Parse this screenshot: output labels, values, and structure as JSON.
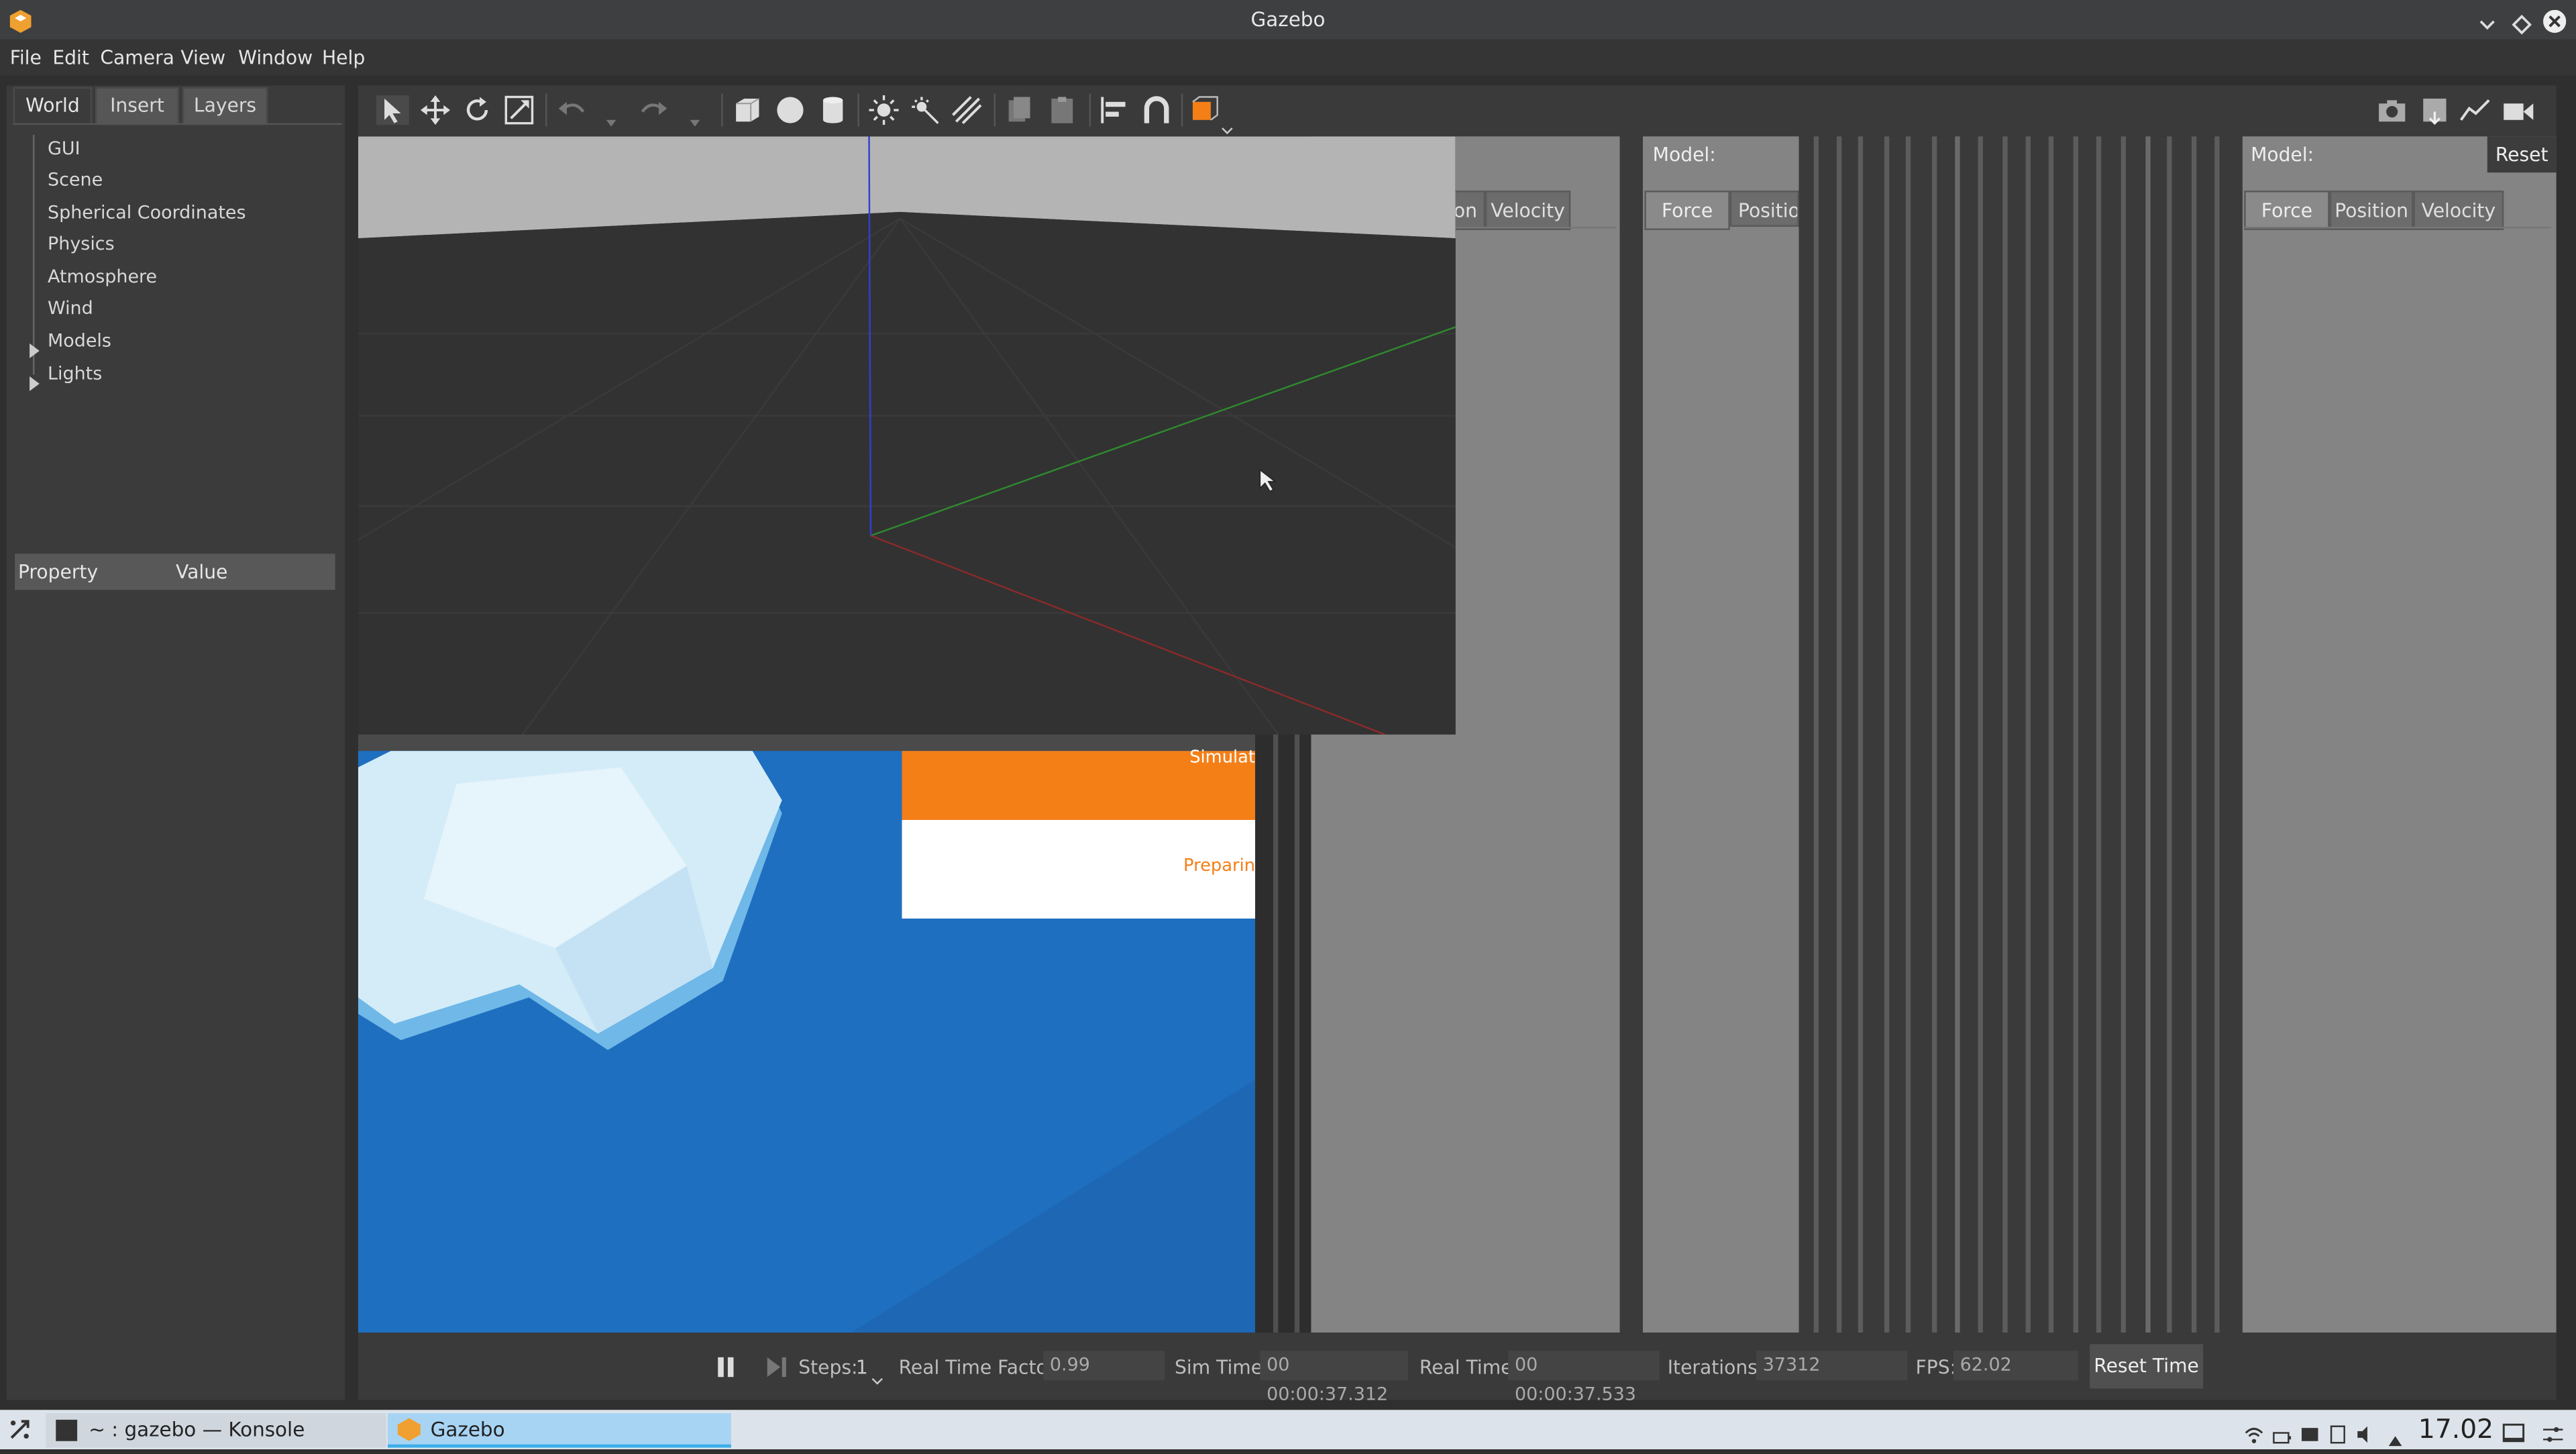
{
  "window": {
    "title": "Gazebo"
  },
  "menu": [
    "File",
    "Edit",
    "Camera",
    "View",
    "Window",
    "Help"
  ],
  "left_tabs": [
    "World",
    "Insert",
    "Layers"
  ],
  "tree": [
    "GUI",
    "Scene",
    "Spherical Coordinates",
    "Physics",
    "Atmosphere",
    "Wind",
    "Models",
    "Lights"
  ],
  "properties": {
    "col1": "Property",
    "col2": "Value"
  },
  "panel1": {
    "tab_partial": "on",
    "tab_velocity": "Velocity"
  },
  "panel2": {
    "model_label": "Model:",
    "tab_force": "Force",
    "tab_position": "Position"
  },
  "panel3": {
    "model_label": "Model:",
    "reset": "Reset",
    "tab_force": "Force",
    "tab_position": "Position",
    "tab_velocity": "Velocity"
  },
  "splash": {
    "simulat": "Simulat",
    "preparing": "Preparin"
  },
  "bottom": {
    "steps_label": "Steps:",
    "steps_value": "1",
    "rtf_label": "Real Time Factor:",
    "rtf_value": "0.99",
    "sim_label": "Sim Time:",
    "sim_value": "00 00:00:37.312",
    "real_label": "Real Time:",
    "real_value": "00 00:00:37.533",
    "iter_label": "Iterations:",
    "iter_value": "37312",
    "fps_label": "FPS:",
    "fps_value": "62.02",
    "reset_time": "Reset Time"
  },
  "taskbar": {
    "task1": "~ : gazebo — Konsole",
    "task2": "Gazebo",
    "clock": "17.02"
  },
  "colors": {
    "accent_orange": "#f57f17",
    "splash_blue": "#1f73c4",
    "taskbar": "#dde3ea"
  }
}
